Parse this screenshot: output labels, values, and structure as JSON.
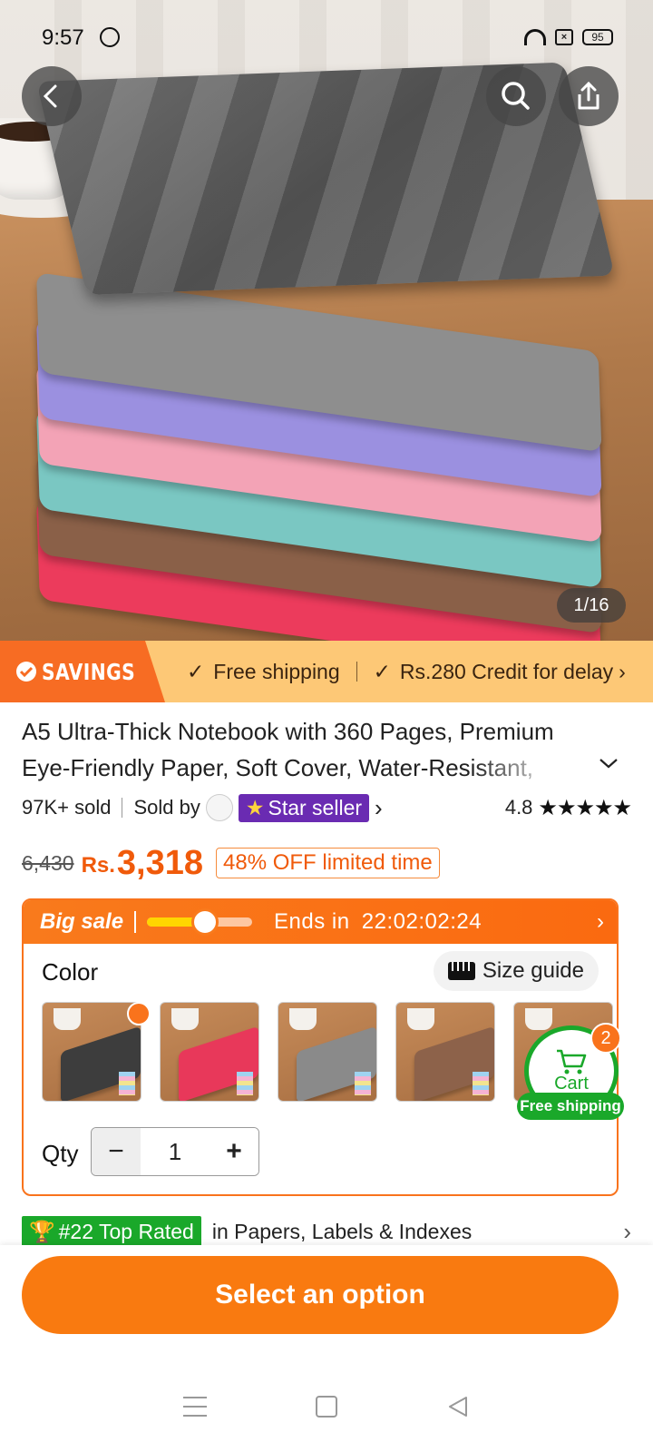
{
  "status_bar": {
    "time": "9:57",
    "battery": "95"
  },
  "hero": {
    "image_counter": "1/16"
  },
  "savings_bar": {
    "tag": "SAVINGS",
    "benefits": [
      "Free shipping",
      "Rs.280 Credit for delay"
    ]
  },
  "product": {
    "title": "A5 Ultra-Thick Notebook with 360 Pages, Premium Eye-Friendly Paper, Soft Cover, Water-Resistant,",
    "sold": "97K+ sold",
    "sold_by": "Sold by",
    "seller_badge": "Star seller",
    "rating": "4.8",
    "rating_stars": "★★★★★"
  },
  "price": {
    "original": "6,430",
    "currency": "Rs.",
    "current": "3,318",
    "discount": "48% OFF limited time"
  },
  "sale": {
    "label": "Big sale",
    "ends_prefix": "Ends in",
    "countdown": "22:02:02:24",
    "progress": 0.55
  },
  "options": {
    "color_label": "Color",
    "size_guide": "Size guide",
    "swatches": [
      {
        "name": "black",
        "color": "#3d3d3d"
      },
      {
        "name": "red",
        "color": "#e8385a"
      },
      {
        "name": "grey",
        "color": "#8a8a8a"
      },
      {
        "name": "brown",
        "color": "#8d624a"
      },
      {
        "name": "purple",
        "color": "#8f86d6"
      }
    ],
    "qty_label": "Qty",
    "qty_value": "1",
    "qty_minus": "−",
    "qty_plus": "+"
  },
  "cart": {
    "label": "Cart",
    "count": "2",
    "free_shipping": "Free shipping"
  },
  "top_rated": {
    "tag": "#22 Top Rated",
    "category": "in Papers, Labels & Indexes"
  },
  "cta": {
    "select_option": "Select an option"
  },
  "colors": {
    "accent": "#f97a10",
    "green": "#1aa82a",
    "star_seller": "#6a2bb2"
  }
}
